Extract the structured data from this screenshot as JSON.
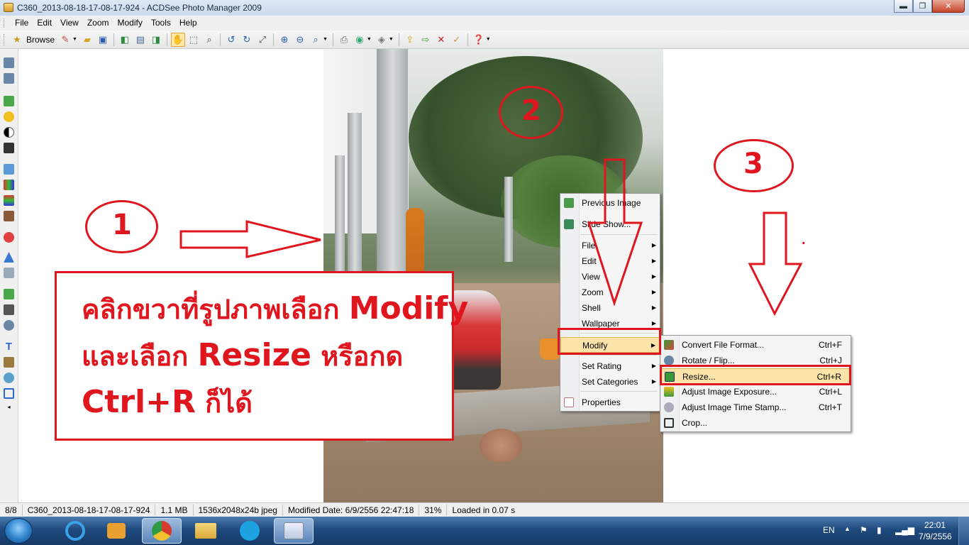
{
  "window": {
    "title": "C360_2013-08-18-17-08-17-924 - ACDSee Photo Manager 2009",
    "buttons": {
      "minimize": "▬",
      "maximize": "❐",
      "close": "✕"
    }
  },
  "menubar": [
    "File",
    "Edit",
    "View",
    "Zoom",
    "Modify",
    "Tools",
    "Help"
  ],
  "toolbar": {
    "browse_label": "Browse"
  },
  "annotations": {
    "num1": "1",
    "num2": "2",
    "num3": "3",
    "dot": ".",
    "line1_prefix": "คลิกขวาที่รูปภาพเลือก ",
    "line1_bold": "Modify",
    "line2_prefix": "และเลือก ",
    "line2_bold": "Resize",
    "line2_suffix": " หรือกด",
    "line3_bold": "Ctrl+R",
    "line3_suffix": " ก็ได้"
  },
  "context_menu": {
    "items": [
      {
        "label": "Previous Image",
        "icon": "previous-image-icon"
      },
      {
        "label": "Slide Show...",
        "icon": "slideshow-icon"
      },
      {
        "label": "File",
        "submenu": true
      },
      {
        "label": "Edit",
        "submenu": true
      },
      {
        "label": "View",
        "submenu": true
      },
      {
        "label": "Zoom",
        "submenu": true
      },
      {
        "label": "Shell",
        "submenu": true
      },
      {
        "label": "Wallpaper",
        "submenu": true
      },
      {
        "label": "Modify",
        "submenu": true,
        "highlighted": true
      },
      {
        "label": "Set Rating",
        "submenu": true
      },
      {
        "label": "Set Categories",
        "submenu": true
      },
      {
        "label": "Properties",
        "icon": "properties-icon"
      }
    ]
  },
  "modify_submenu": {
    "items": [
      {
        "label": "Convert File Format...",
        "shortcut": "Ctrl+F"
      },
      {
        "label": "Rotate / Flip...",
        "shortcut": "Ctrl+J"
      },
      {
        "label": "Resize...",
        "shortcut": "Ctrl+R",
        "highlighted": true
      },
      {
        "label": "Adjust Image Exposure...",
        "shortcut": "Ctrl+L"
      },
      {
        "label": "Adjust Image Time Stamp...",
        "shortcut": "Ctrl+T"
      },
      {
        "label": "Crop...",
        "shortcut": ""
      }
    ]
  },
  "statusbar": {
    "index": "8/8",
    "filename": "C360_2013-08-18-17-08-17-924",
    "size": "1.1 MB",
    "dimensions": "1536x2048x24b jpeg",
    "modified": "Modified Date: 6/9/2556 22:47:18",
    "zoom": "31%",
    "load_time": "Loaded in 0.07 s"
  },
  "taskbar": {
    "language": "EN",
    "time": "22:01",
    "date": "7/9/2556"
  },
  "colors": {
    "annotation_red": "#e0161f",
    "menu_highlight": "#fbe3a9"
  }
}
